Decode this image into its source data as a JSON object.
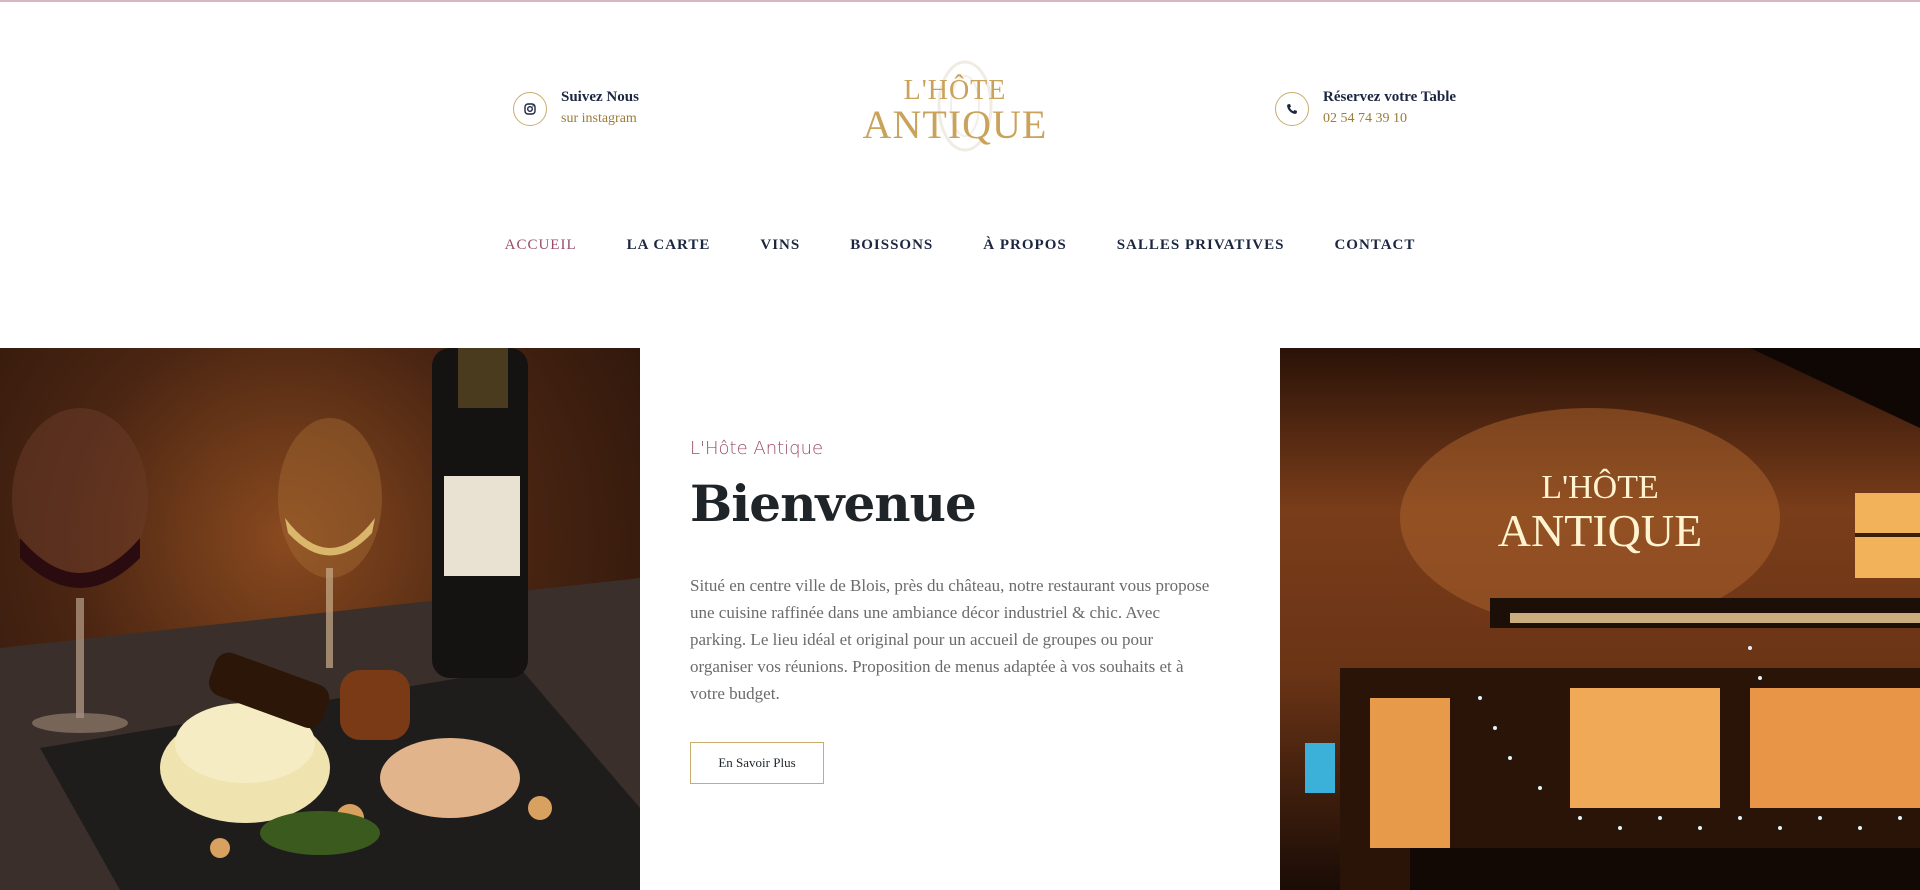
{
  "header": {
    "instagram": {
      "title": "Suivez Nous",
      "subtitle": "sur instagram",
      "icon": "instagram-icon"
    },
    "reservation": {
      "title": "Réservez votre Table",
      "subtitle": "02 54 74 39 10",
      "icon": "phone-icon"
    },
    "logo": {
      "line1": "L'HÔTE",
      "line2": "ANTIQUE"
    }
  },
  "nav": {
    "items": [
      {
        "label": "ACCUEIL",
        "active": true
      },
      {
        "label": "LA CARTE"
      },
      {
        "label": "VINS"
      },
      {
        "label": "BOISSONS"
      },
      {
        "label": "À PROPOS"
      },
      {
        "label": "SALLES PRIVATIVES"
      },
      {
        "label": "CONTACT"
      }
    ]
  },
  "hero": {
    "eyebrow": "L'Hôte Antique",
    "title": "Bienvenue",
    "paragraph": "Situé en centre ville de Blois, près du château, notre restaurant vous propose une cuisine raffinée dans une ambiance décor industriel & chic. Avec parking. Le lieu idéal et original pour un accueil de groupes ou pour organiser vos réunions. Proposition de menus adaptée à vos souhaits et à votre budget.",
    "button_label": "En Savoir Plus",
    "sign_line1": "L'HÔTE",
    "sign_line2": "ANTIQUE"
  },
  "colors": {
    "accent_gold": "#c8ad6e",
    "accent_rose": "#9a4b6a",
    "navy": "#1c2640"
  }
}
